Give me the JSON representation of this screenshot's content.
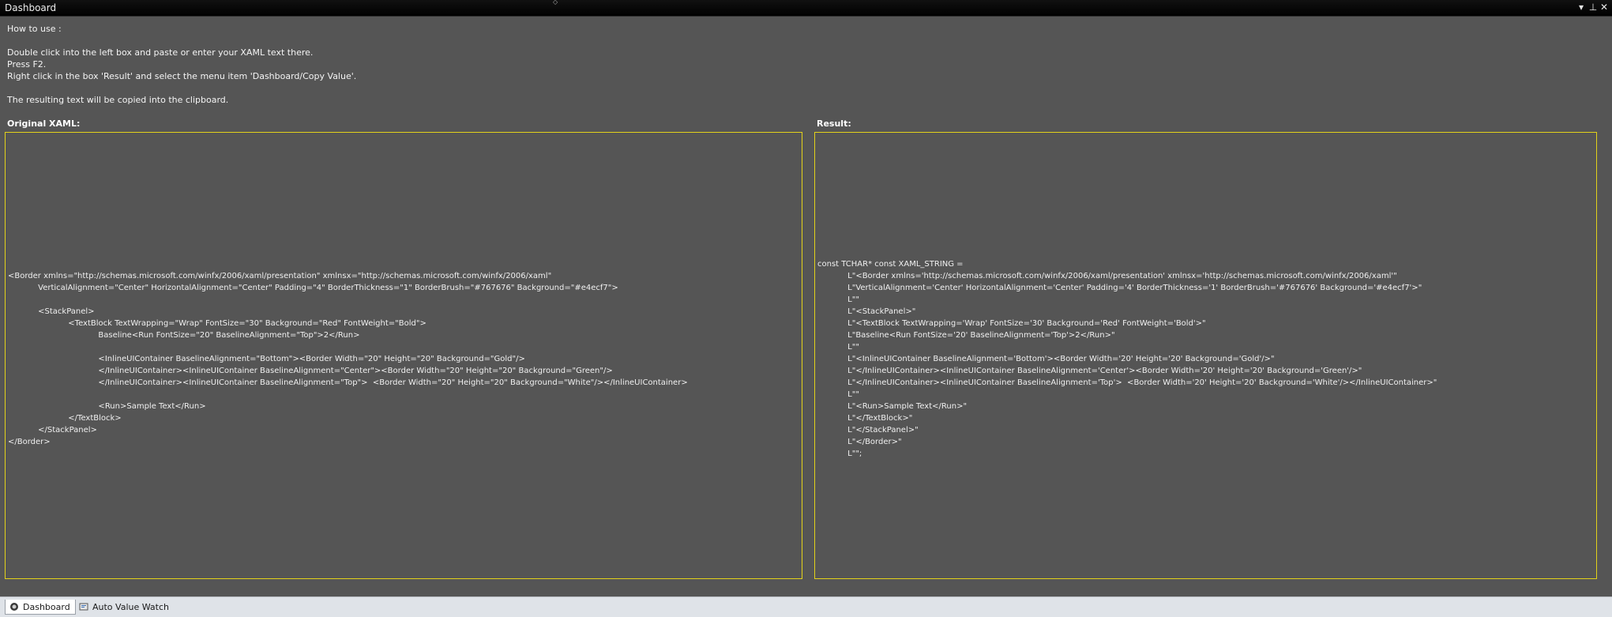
{
  "window": {
    "title": "Dashboard",
    "buttons": {
      "menu": "▾",
      "pin": "⊥",
      "close": "✕"
    }
  },
  "instructions": {
    "heading": "How to use :",
    "lines": [
      "Double click into the left box and paste or enter your XAML text there.",
      "Press F2.",
      "Right click in the box 'Result' and select the menu item 'Dashboard/Copy Value'."
    ],
    "footer": "The resulting text will be copied into the clipboard."
  },
  "original_panel": {
    "label": "Original XAML:",
    "lines": [
      "<Border xmlns=\"http://schemas.microsoft.com/winfx/2006/xaml/presentation\" xmlnsx=\"http://schemas.microsoft.com/winfx/2006/xaml\"",
      "            VerticalAlignment=\"Center\" HorizontalAlignment=\"Center\" Padding=\"4\" BorderThickness=\"1\" BorderBrush=\"#767676\" Background=\"#e4ecf7\">",
      "",
      "            <StackPanel>",
      "                        <TextBlock TextWrapping=\"Wrap\" FontSize=\"30\" Background=\"Red\" FontWeight=\"Bold\">",
      "                                    Baseline<Run FontSize=\"20\" BaselineAlignment=\"Top\">2</Run>",
      "",
      "                                    <InlineUIContainer BaselineAlignment=\"Bottom\"><Border Width=\"20\" Height=\"20\" Background=\"Gold\"/>",
      "                                    </InlineUIContainer><InlineUIContainer BaselineAlignment=\"Center\"><Border Width=\"20\" Height=\"20\" Background=\"Green\"/>",
      "                                    </InlineUIContainer><InlineUIContainer BaselineAlignment=\"Top\">  <Border Width=\"20\" Height=\"20\" Background=\"White\"/></InlineUIContainer>",
      "",
      "                                    <Run>Sample Text</Run>",
      "                        </TextBlock>",
      "            </StackPanel>",
      "</Border>"
    ]
  },
  "result_panel": {
    "label": "Result:",
    "lines": [
      "const TCHAR* const XAML_STRING =",
      "            L\"<Border xmlns='http://schemas.microsoft.com/winfx/2006/xaml/presentation' xmlnsx='http://schemas.microsoft.com/winfx/2006/xaml'\"",
      "            L\"VerticalAlignment='Center' HorizontalAlignment='Center' Padding='4' BorderThickness='1' BorderBrush='#767676' Background='#e4ecf7'>\"",
      "            L\"\"",
      "            L\"<StackPanel>\"",
      "            L\"<TextBlock TextWrapping='Wrap' FontSize='30' Background='Red' FontWeight='Bold'>\"",
      "            L\"Baseline<Run FontSize='20' BaselineAlignment='Top'>2</Run>\"",
      "            L\"\"",
      "            L\"<InlineUIContainer BaselineAlignment='Bottom'><Border Width='20' Height='20' Background='Gold'/>\"",
      "            L\"</InlineUIContainer><InlineUIContainer BaselineAlignment='Center'><Border Width='20' Height='20' Background='Green'/>\"",
      "            L\"</InlineUIContainer><InlineUIContainer BaselineAlignment='Top'>  <Border Width='20' Height='20' Background='White'/></InlineUIContainer>\"",
      "            L\"\"",
      "            L\"<Run>Sample Text</Run>\"",
      "            L\"</TextBlock>\"",
      "            L\"</StackPanel>\"",
      "            L\"</Border>\"",
      "            L\"\";"
    ]
  },
  "tabs": [
    {
      "label": "Dashboard",
      "icon": "dashboard-icon",
      "active": true
    },
    {
      "label": "Auto Value Watch",
      "icon": "watch-icon",
      "active": false
    }
  ],
  "colors": {
    "background": "#555555",
    "box_border": "#e3d21a",
    "titlebar": "#000000",
    "statusbar": "#dfe3e8"
  }
}
